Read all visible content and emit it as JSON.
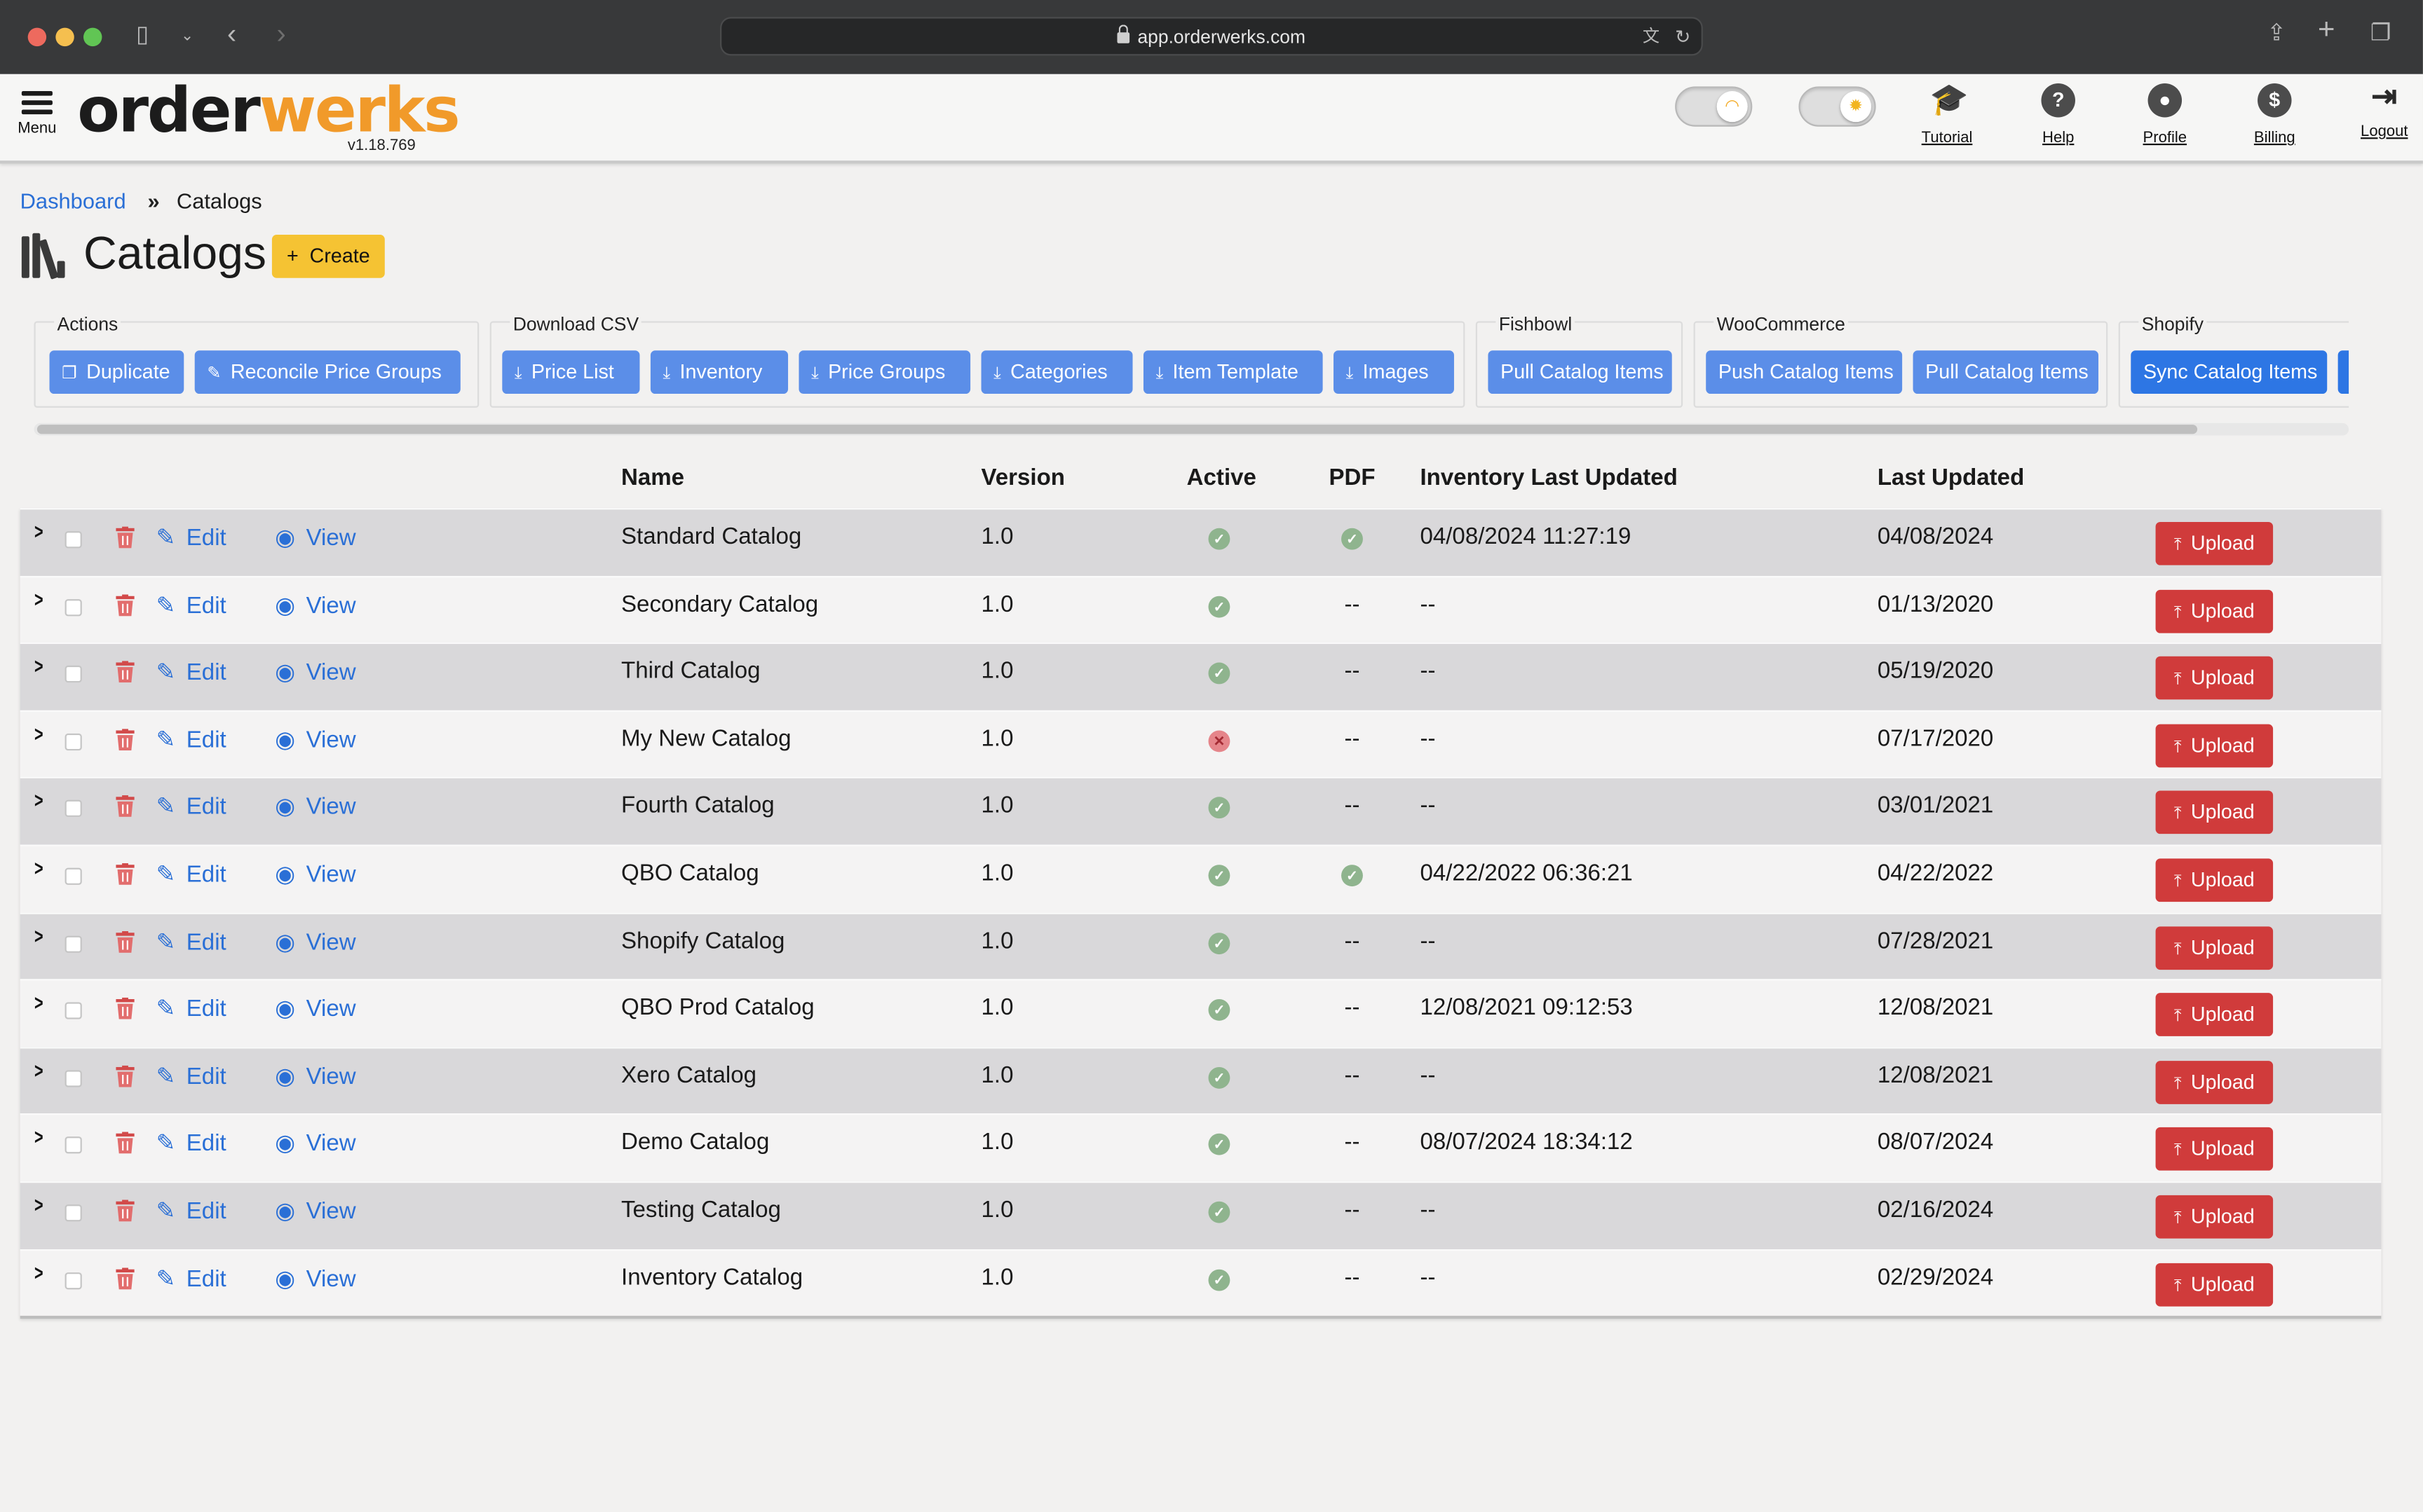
{
  "browser": {
    "url": "app.orderwerks.com"
  },
  "header": {
    "menu_label": "Menu",
    "logo_part1": "order",
    "logo_part2": "werks",
    "version": "v1.18.769",
    "nav": [
      {
        "label": "Tutorial",
        "icon": "graduation-cap-icon"
      },
      {
        "label": "Help",
        "icon": "question-icon"
      },
      {
        "label": "Profile",
        "icon": "user-icon"
      },
      {
        "label": "Billing",
        "icon": "dollar-icon"
      },
      {
        "label": "Logout",
        "icon": "logout-icon"
      }
    ]
  },
  "breadcrumb": {
    "root": "Dashboard",
    "separator": "»",
    "current": "Catalogs"
  },
  "page": {
    "title": "Catalogs",
    "create_label": "Create"
  },
  "toolbar": {
    "groups": [
      {
        "label": "Actions",
        "buttons": [
          "Duplicate",
          "Reconcile Price Groups"
        ]
      },
      {
        "label": "Download CSV",
        "buttons": [
          "Price List",
          "Inventory",
          "Price Groups",
          "Categories",
          "Item Template",
          "Images"
        ]
      },
      {
        "label": "Fishbowl",
        "buttons": [
          "Pull Catalog Items"
        ]
      },
      {
        "label": "WooCommerce",
        "buttons": [
          "Push Catalog Items",
          "Pull Catalog Items"
        ]
      },
      {
        "label": "Shopify",
        "buttons": [
          "Sync Catalog Items"
        ]
      }
    ]
  },
  "table": {
    "columns": {
      "name": "Name",
      "version": "Version",
      "active": "Active",
      "pdf": "PDF",
      "inventory_last_updated": "Inventory Last Updated",
      "last_updated": "Last Updated"
    },
    "edit_label": "Edit",
    "view_label": "View",
    "upload_label": "Upload",
    "rows": [
      {
        "name": "Standard Catalog",
        "version": "1.0",
        "active": true,
        "pdf": true,
        "inventory_last_updated": "04/08/2024 11:27:19",
        "last_updated": "04/08/2024"
      },
      {
        "name": "Secondary Catalog",
        "version": "1.0",
        "active": true,
        "pdf": false,
        "inventory_last_updated": "--",
        "last_updated": "01/13/2020"
      },
      {
        "name": "Third Catalog",
        "version": "1.0",
        "active": true,
        "pdf": false,
        "inventory_last_updated": "--",
        "last_updated": "05/19/2020"
      },
      {
        "name": "My New Catalog",
        "version": "1.0",
        "active": false,
        "pdf": false,
        "inventory_last_updated": "--",
        "last_updated": "07/17/2020"
      },
      {
        "name": "Fourth Catalog",
        "version": "1.0",
        "active": true,
        "pdf": false,
        "inventory_last_updated": "--",
        "last_updated": "03/01/2021"
      },
      {
        "name": "QBO Catalog",
        "version": "1.0",
        "active": true,
        "pdf": true,
        "inventory_last_updated": "04/22/2022 06:36:21",
        "last_updated": "04/22/2022"
      },
      {
        "name": "Shopify Catalog",
        "version": "1.0",
        "active": true,
        "pdf": false,
        "inventory_last_updated": "--",
        "last_updated": "07/28/2021"
      },
      {
        "name": "QBO Prod Catalog",
        "version": "1.0",
        "active": true,
        "pdf": false,
        "inventory_last_updated": "12/08/2021 09:12:53",
        "last_updated": "12/08/2021"
      },
      {
        "name": "Xero Catalog",
        "version": "1.0",
        "active": true,
        "pdf": false,
        "inventory_last_updated": "--",
        "last_updated": "12/08/2021"
      },
      {
        "name": "Demo Catalog",
        "version": "1.0",
        "active": true,
        "pdf": false,
        "inventory_last_updated": "08/07/2024 18:34:12",
        "last_updated": "08/07/2024"
      },
      {
        "name": "Testing Catalog",
        "version": "1.0",
        "active": true,
        "pdf": false,
        "inventory_last_updated": "--",
        "last_updated": "02/16/2024"
      },
      {
        "name": "Inventory Catalog",
        "version": "1.0",
        "active": true,
        "pdf": false,
        "inventory_last_updated": "--",
        "last_updated": "02/29/2024"
      }
    ],
    "empty_marker": "--"
  },
  "colors": {
    "accent_blue": "#5b8ee8",
    "link_blue": "#2a6fd6",
    "create_yellow": "#f5c333",
    "upload_red": "#d03b3b",
    "logo_orange": "#f19a2a"
  }
}
